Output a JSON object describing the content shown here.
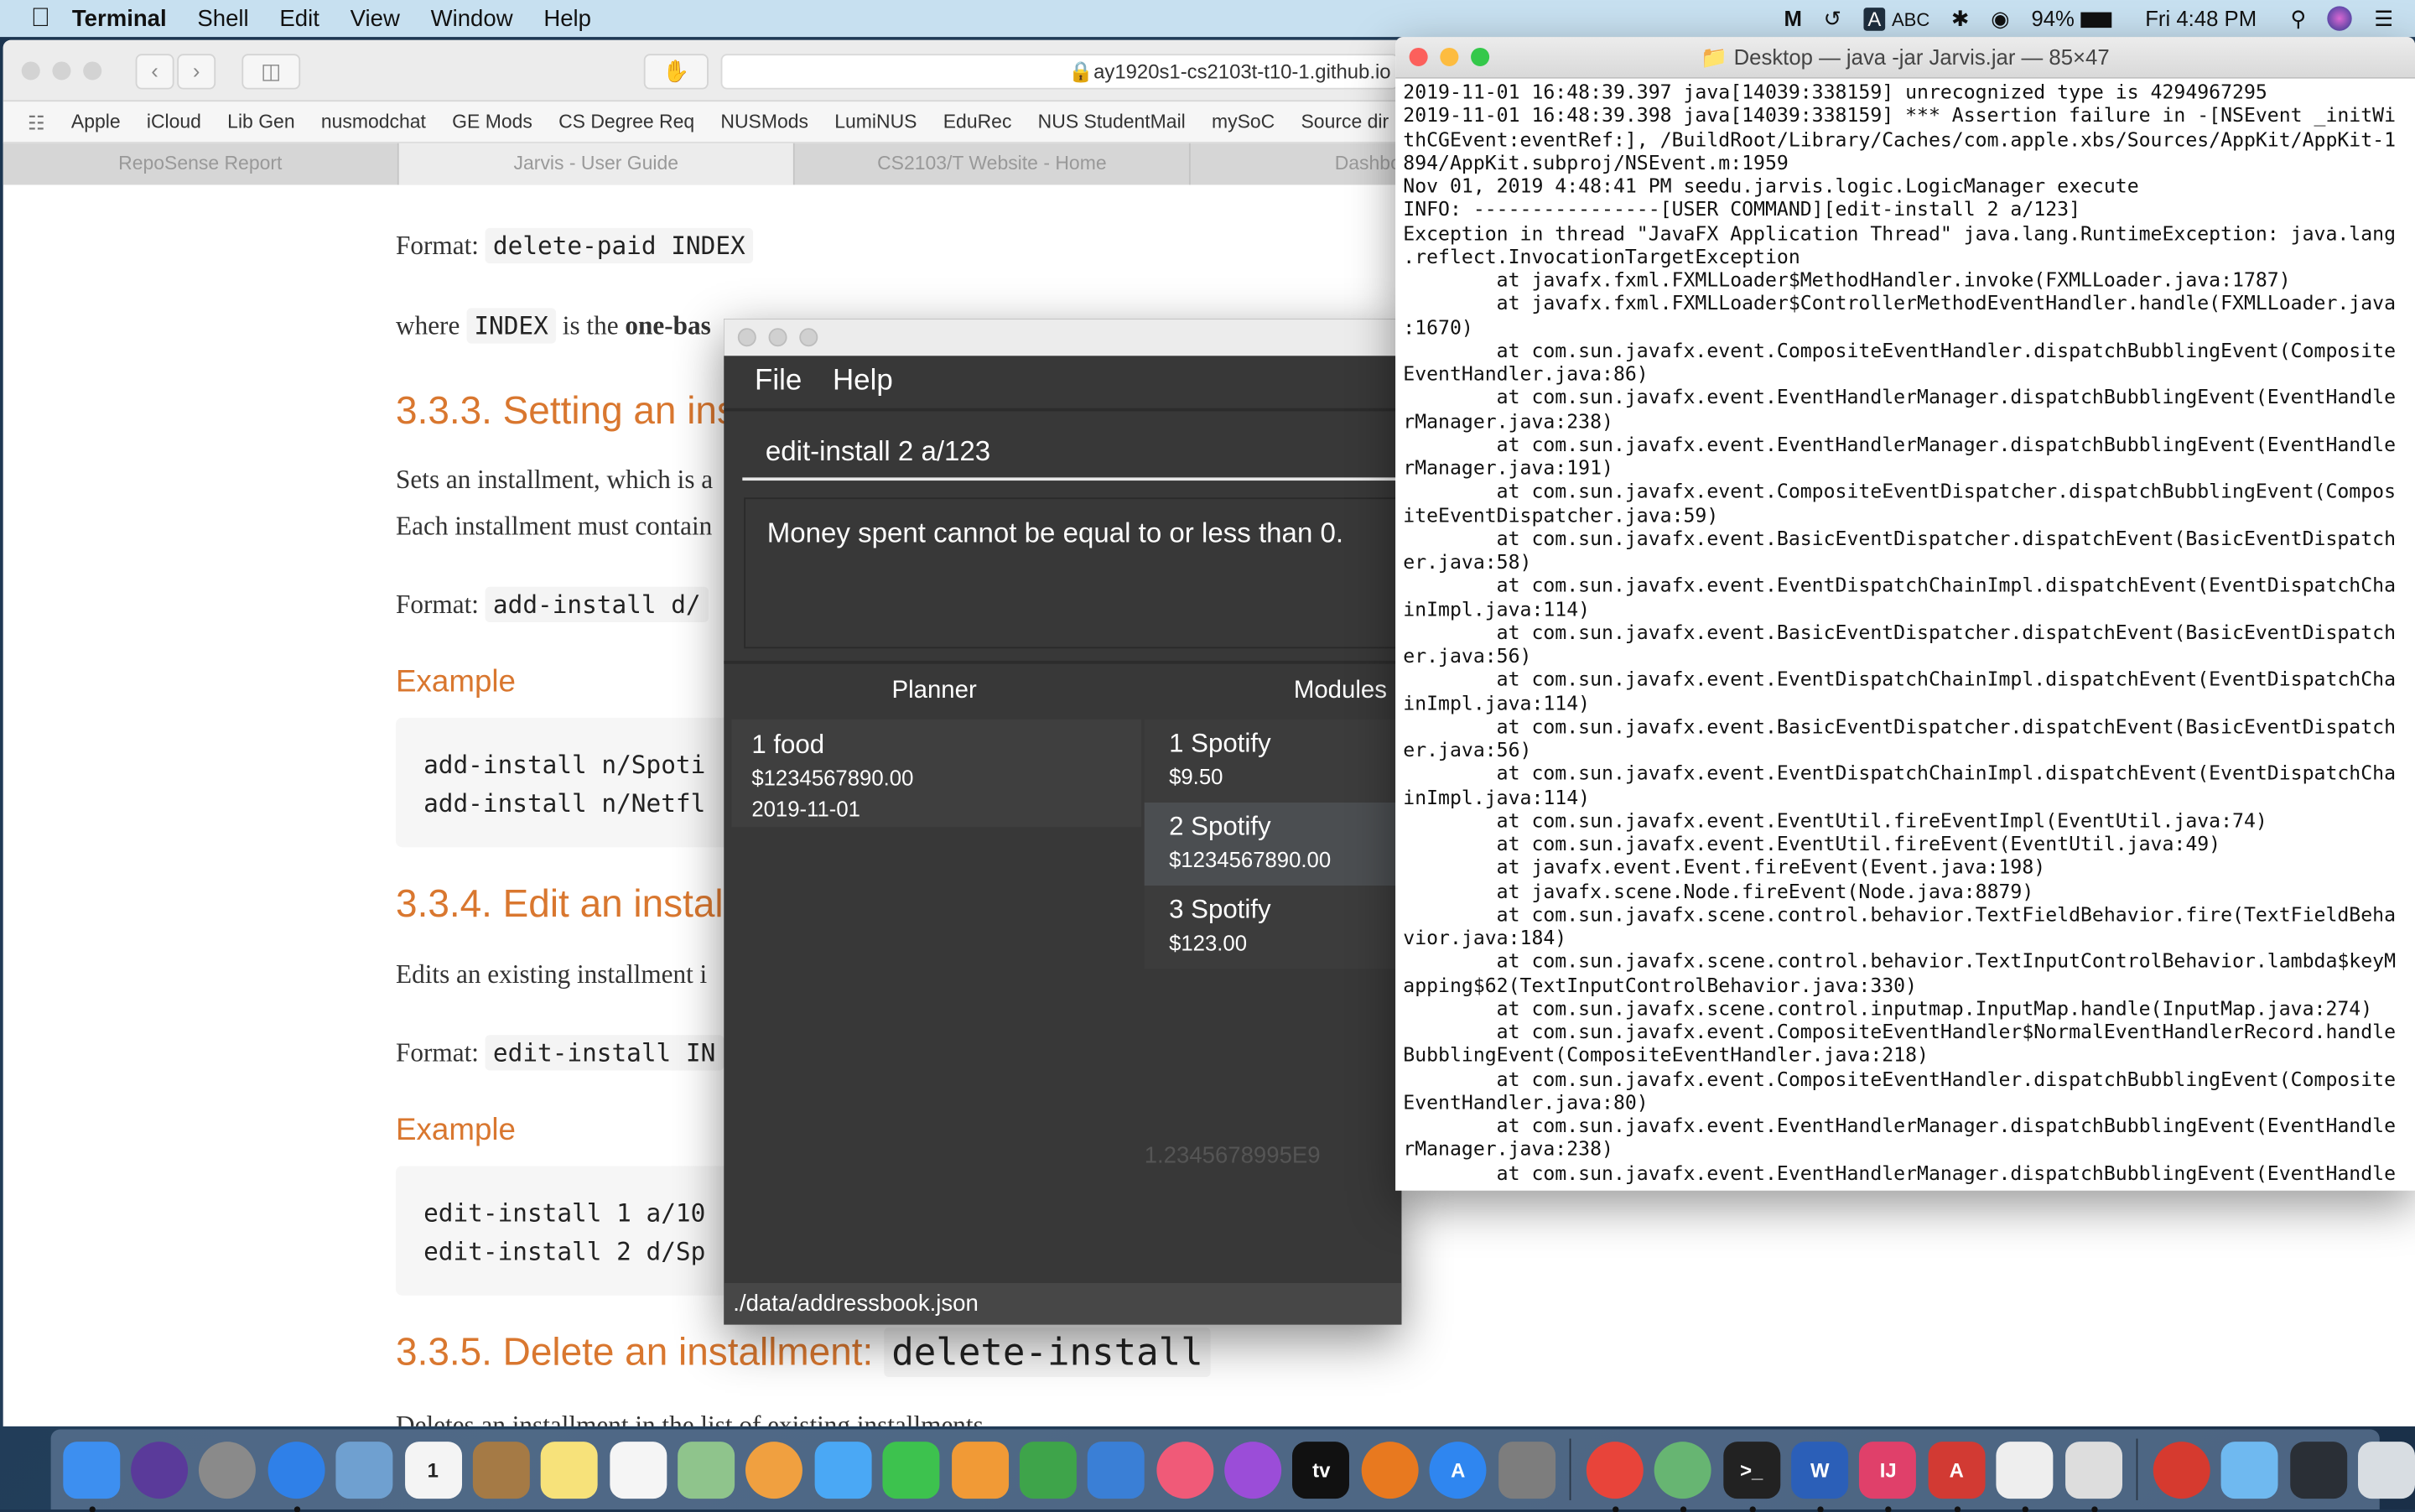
{
  "menubar": {
    "app": "Terminal",
    "items": [
      "Shell",
      "Edit",
      "View",
      "Window",
      "Help"
    ],
    "status": {
      "input_badge": "A",
      "input_source": "ABC",
      "battery": "94%",
      "clock": "Fri 4:48 PM"
    }
  },
  "browser": {
    "url": "ay1920s1-cs2103t-t10-1.github.io",
    "bookmarks": [
      "Apple",
      "iCloud",
      "Lib Gen",
      "nusmodchat",
      "GE Mods",
      "CS Degree Req",
      "NUSMods",
      "LumiNUS",
      "EduRec",
      "NUS StudentMail",
      "mySoC",
      "Source dir"
    ],
    "tabs": [
      {
        "label": "RepoSense Report",
        "active": false
      },
      {
        "label": "Jarvis - User Guide",
        "active": true
      },
      {
        "label": "CS2103/T Website - Home",
        "active": false
      },
      {
        "label": "Dashboard - ",
        "active": false
      }
    ],
    "content": {
      "format_label": "Format:",
      "format1_code": "delete-paid INDEX",
      "where_text": "where",
      "where_code": "INDEX",
      "where_rest": "is the",
      "where_bold": "one-bas",
      "h333": "3.3.3. Setting an ins",
      "sets_text": "Sets an installment, which is a",
      "each_text": "Each installment must contain",
      "format2_code": "add-install d/",
      "example_label": "Example",
      "code1": [
        "add-install n/Spoti",
        "add-install n/Netfl"
      ],
      "h334": "3.3.4. Edit an instal",
      "edits_text": "Edits an existing installment i",
      "format3_code": "edit-install IN",
      "code2": [
        "edit-install 1 a/10",
        "edit-install 2 d/Sp"
      ],
      "h335": "3.3.5. Delete an installment:",
      "h335_code": "delete-install",
      "cut_text": "Deletes an installment in the list of existing installments."
    }
  },
  "jarvis": {
    "menu": [
      "File",
      "Help"
    ],
    "command": "edit-install 2 a/123",
    "result": "Money spent cannot be equal to or less than 0.",
    "tabs": [
      "Planner",
      "Modules"
    ],
    "planner": [
      {
        "title": "1 food",
        "amount": "$1234567890.00",
        "date": "2019-11-01"
      }
    ],
    "installments": [
      {
        "title": "1 Spotify",
        "amount": "$9.50",
        "selected": false
      },
      {
        "title": "2 Spotify",
        "amount": "$1234567890.00",
        "selected": true
      },
      {
        "title": "3 Spotify",
        "amount": "$123.00",
        "selected": false
      }
    ],
    "total": "1.2345678995E9",
    "status_path": "./data/addressbook.json"
  },
  "terminal": {
    "title": "Desktop — java -jar Jarvis.jar — 85×47",
    "lines": [
      "2019-11-01 16:48:39.397 java[14039:338159] unrecognized type is 4294967295",
      "2019-11-01 16:48:39.398 java[14039:338159] *** Assertion failure in -[NSEvent _initWi",
      "thCGEvent:eventRef:], /BuildRoot/Library/Caches/com.apple.xbs/Sources/AppKit/AppKit-1",
      "894/AppKit.subproj/NSEvent.m:1959",
      "Nov 01, 2019 4:48:41 PM seedu.jarvis.logic.LogicManager execute",
      "INFO: ----------------[USER COMMAND][edit-install 2 a/123]",
      "Exception in thread \"JavaFX Application Thread\" java.lang.RuntimeException: java.lang",
      ".reflect.InvocationTargetException",
      "        at javafx.fxml.FXMLLoader$MethodHandler.invoke(FXMLLoader.java:1787)",
      "        at javafx.fxml.FXMLLoader$ControllerMethodEventHandler.handle(FXMLLoader.java",
      ":1670)",
      "        at com.sun.javafx.event.CompositeEventHandler.dispatchBubblingEvent(Composite",
      "EventHandler.java:86)",
      "        at com.sun.javafx.event.EventHandlerManager.dispatchBubblingEvent(EventHandle",
      "rManager.java:238)",
      "        at com.sun.javafx.event.EventHandlerManager.dispatchBubblingEvent(EventHandle",
      "rManager.java:191)",
      "        at com.sun.javafx.event.CompositeEventDispatcher.dispatchBubblingEvent(Compos",
      "iteEventDispatcher.java:59)",
      "        at com.sun.javafx.event.BasicEventDispatcher.dispatchEvent(BasicEventDispatch",
      "er.java:58)",
      "        at com.sun.javafx.event.EventDispatchChainImpl.dispatchEvent(EventDispatchCha",
      "inImpl.java:114)",
      "        at com.sun.javafx.event.BasicEventDispatcher.dispatchEvent(BasicEventDispatch",
      "er.java:56)",
      "        at com.sun.javafx.event.EventDispatchChainImpl.dispatchEvent(EventDispatchCha",
      "inImpl.java:114)",
      "        at com.sun.javafx.event.BasicEventDispatcher.dispatchEvent(BasicEventDispatch",
      "er.java:56)",
      "        at com.sun.javafx.event.EventDispatchChainImpl.dispatchEvent(EventDispatchCha",
      "inImpl.java:114)",
      "        at com.sun.javafx.event.EventUtil.fireEventImpl(EventUtil.java:74)",
      "        at com.sun.javafx.event.EventUtil.fireEvent(EventUtil.java:49)",
      "        at javafx.event.Event.fireEvent(Event.java:198)",
      "        at javafx.scene.Node.fireEvent(Node.java:8879)",
      "        at com.sun.javafx.scene.control.behavior.TextFieldBehavior.fire(TextFieldBeha",
      "vior.java:184)",
      "        at com.sun.javafx.scene.control.behavior.TextInputControlBehavior.lambda$keyM",
      "apping$62(TextInputControlBehavior.java:330)",
      "        at com.sun.javafx.scene.control.inputmap.InputMap.handle(InputMap.java:274)",
      "        at com.sun.javafx.event.CompositeEventHandler$NormalEventHandlerRecord.handle",
      "BubblingEvent(CompositeEventHandler.java:218)",
      "        at com.sun.javafx.event.CompositeEventHandler.dispatchBubblingEvent(Composite",
      "EventHandler.java:80)",
      "        at com.sun.javafx.event.EventHandlerManager.dispatchBubblingEvent(EventHandle",
      "rManager.java:238)",
      "        at com.sun.javafx.event.EventHandlerManager.dispatchBubblingEvent(EventHandle"
    ]
  },
  "dock": [
    {
      "icon": "finder",
      "color": "#3d8ff0",
      "running": true
    },
    {
      "icon": "siri",
      "color": "#5a3a9a",
      "running": false
    },
    {
      "icon": "launchpad",
      "color": "#8a8a8a",
      "running": false
    },
    {
      "icon": "safari",
      "color": "#2f80e8",
      "running": true
    },
    {
      "icon": "mail",
      "color": "#6fa0d0",
      "running": false
    },
    {
      "icon": "calendar",
      "color": "#f4f4f4",
      "glyph": "1",
      "running": false
    },
    {
      "icon": "contacts",
      "color": "#a57a45",
      "running": false
    },
    {
      "icon": "notes",
      "color": "#f7e27a",
      "running": false
    },
    {
      "icon": "reminders",
      "color": "#f5f5f5",
      "running": false
    },
    {
      "icon": "maps",
      "color": "#8fc48c",
      "running": false
    },
    {
      "icon": "photos",
      "color": "#f0a040",
      "running": false
    },
    {
      "icon": "messages",
      "color": "#4aa8f5",
      "running": false
    },
    {
      "icon": "facetime",
      "color": "#3dc24e",
      "running": false
    },
    {
      "icon": "pages",
      "color": "#f19a36",
      "running": false
    },
    {
      "icon": "numbers",
      "color": "#3ea44a",
      "running": false
    },
    {
      "icon": "keynote",
      "color": "#3a7fd6",
      "running": false
    },
    {
      "icon": "music",
      "color": "#f05a78",
      "running": false
    },
    {
      "icon": "podcasts",
      "color": "#9b4dd8",
      "running": false
    },
    {
      "icon": "apple-tv",
      "color": "#111111",
      "glyph": "tv",
      "running": false
    },
    {
      "icon": "books",
      "color": "#e8791f",
      "running": false
    },
    {
      "icon": "app-store",
      "color": "#2f86f0",
      "glyph": "A",
      "running": false
    },
    {
      "icon": "system-preferences",
      "color": "#7d7d7d",
      "running": false
    },
    {
      "icon": "separator"
    },
    {
      "icon": "chrome",
      "color": "#e8443a",
      "running": true
    },
    {
      "icon": "atom",
      "color": "#67b572",
      "running": true
    },
    {
      "icon": "terminal",
      "color": "#222222",
      "glyph": ">_",
      "running": true
    },
    {
      "icon": "word",
      "color": "#2b5fb8",
      "glyph": "W",
      "running": true
    },
    {
      "icon": "intellij",
      "color": "#e0406a",
      "glyph": "IJ",
      "running": true
    },
    {
      "icon": "angular",
      "color": "#d23a33",
      "glyph": "A",
      "running": true
    },
    {
      "icon": "textedit",
      "color": "#eeeeee",
      "running": true
    },
    {
      "icon": "script-editor",
      "color": "#dddddd",
      "running": true
    },
    {
      "icon": "separator"
    },
    {
      "icon": "adblock",
      "color": "#d63a2f",
      "running": false
    },
    {
      "icon": "downloads-folder",
      "color": "#6fb9f0",
      "running": false
    },
    {
      "icon": "screenshot-stack",
      "color": "#2a2f36",
      "running": false
    },
    {
      "icon": "trash",
      "color": "#d8dde2",
      "running": false
    }
  ]
}
